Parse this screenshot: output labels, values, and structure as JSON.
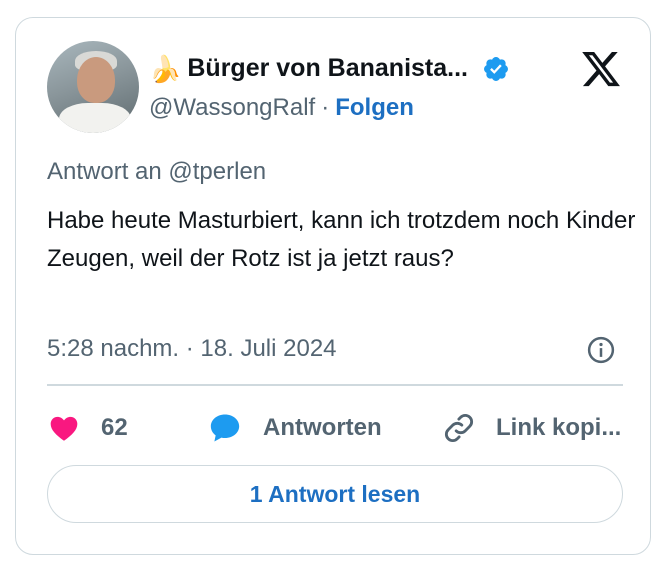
{
  "author": {
    "emoji": "🍌",
    "display_name": "Bürger von Bananista...",
    "handle": "@WassongRalf",
    "separator": "·",
    "follow_label": "Folgen",
    "verified_icon": "verified-badge-icon",
    "avatar_icon": "avatar"
  },
  "brand": {
    "logo": "x-logo-icon"
  },
  "tweet": {
    "reply_to": "Antwort an @tperlen",
    "text": "Habe heute Masturbiert, kann ich trotzdem noch Kinder Zeugen, weil der Rotz ist ja jetzt raus?",
    "timestamp": "5:28 nachm. · 18. Juli 2024"
  },
  "actions": {
    "like_count": "62",
    "reply_label": "Antworten",
    "copy_link_label": "Link kopi..."
  },
  "footer": {
    "read_replies_label": "1 Antwort lesen"
  },
  "colors": {
    "accent_blue": "#1d6fc2",
    "verified_blue": "#1d9bf0",
    "like_pink": "#f91880",
    "muted_text": "#536471",
    "border": "#cfd9de"
  }
}
